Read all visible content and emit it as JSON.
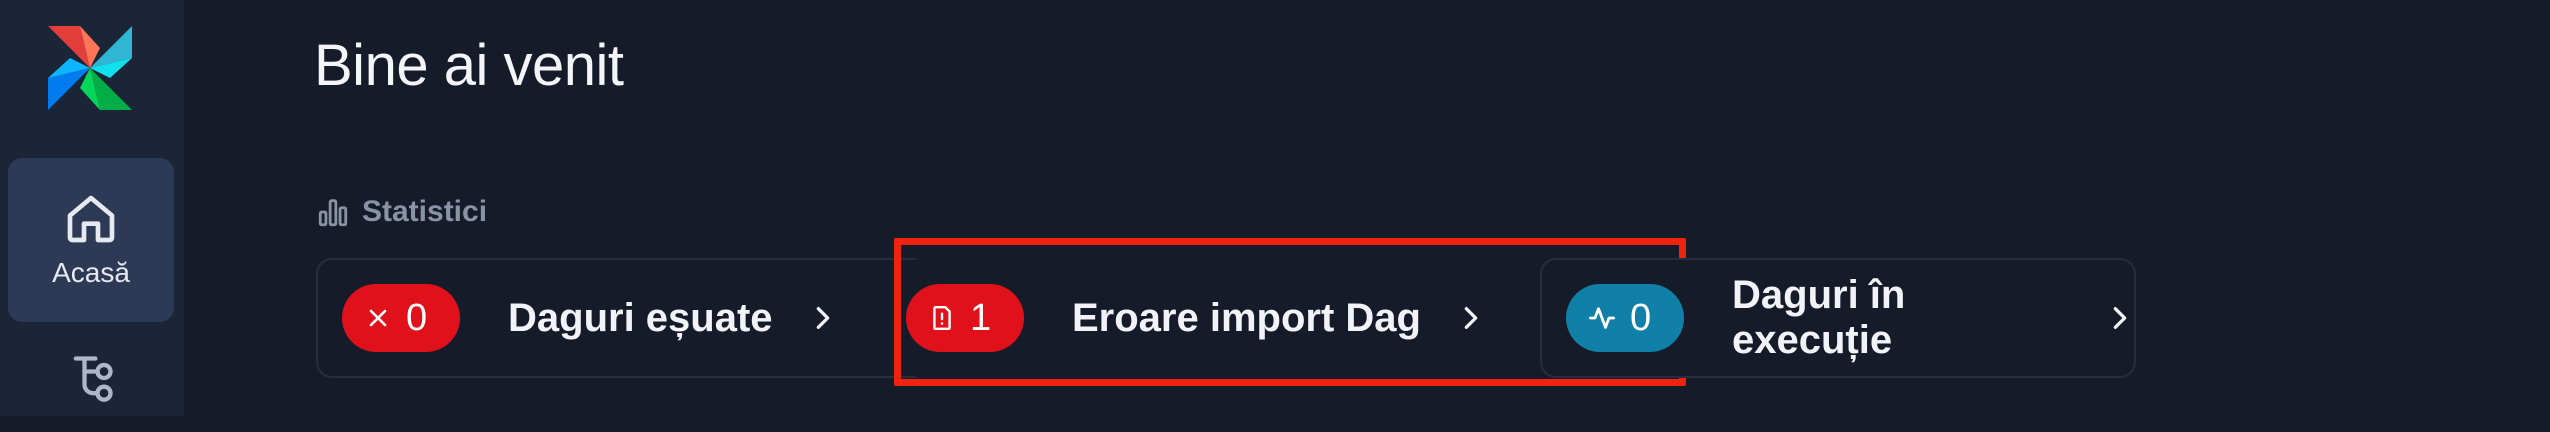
{
  "sidebar": {
    "items": [
      {
        "label": "Acasă",
        "icon": "home-icon",
        "active": true
      },
      {
        "label": "",
        "icon": "dags-icon",
        "active": false
      }
    ]
  },
  "main": {
    "title": "Bine ai venit",
    "stats": {
      "heading": "Statistici",
      "cards": [
        {
          "count": "0",
          "label": "Daguri eșuate",
          "icon": "x-icon",
          "color": "#e0111b"
        },
        {
          "count": "1",
          "label": "Eroare import Dag",
          "icon": "file-alert-icon",
          "color": "#e0111b"
        },
        {
          "count": "0",
          "label": "Daguri în execuție",
          "icon": "activity-icon",
          "color": "#1180a8"
        }
      ]
    }
  },
  "colors": {
    "background": "#161b29",
    "sidebar": "#1c2438",
    "active_nav": "#2c3a56",
    "highlight_border": "#f0230e"
  }
}
